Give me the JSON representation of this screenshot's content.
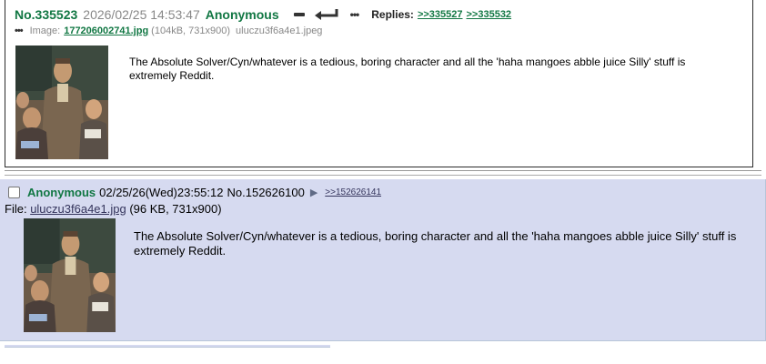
{
  "post1": {
    "number": "No.335523",
    "datetime": "2026/02/25 14:53:47",
    "name": "Anonymous",
    "menu_dots": "•••",
    "replies_label": "Replies:",
    "replies": [
      ">>335527",
      ">>335532"
    ],
    "file_dots": "•••",
    "file_label": "Image:",
    "file_name": "177206002741.jpg",
    "file_meta": "(104kB, 731x900)",
    "file_original": "uluczu3f6a4e1.jpeg",
    "message": "The Absolute Solver/Cyn/whatever is a tedious, boring character and all the 'haha mangoes abble juice Silly' stuff is extremely Reddit.",
    "name_color": "#117743"
  },
  "post2": {
    "name": "Anonymous",
    "datetime": "02/25/26(Wed)23:55:12",
    "number": "No.152626100",
    "arrow": "▶",
    "reply": ">>152626141",
    "file_label": "File:",
    "file_name": "uluczu3f6a4e1.jpg",
    "file_meta": "(96 KB, 731x900)",
    "message": "The Absolute Solver/Cyn/whatever is a tedious, boring character and all the 'haha mangoes abble juice Silly' stuff is extremely Reddit.",
    "background": "#d6daf0"
  }
}
